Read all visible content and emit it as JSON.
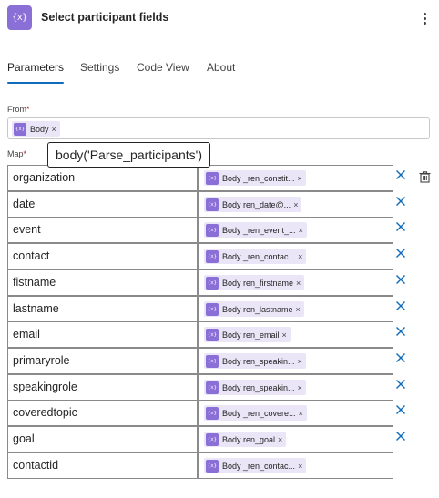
{
  "header": {
    "app_icon": "{x}",
    "title": "Select participant fields",
    "menu_icon": "more-vertical-icon"
  },
  "tabs": [
    {
      "label": "Parameters",
      "active": true
    },
    {
      "label": "Settings",
      "active": false
    },
    {
      "label": "Code View",
      "active": false
    },
    {
      "label": "About",
      "active": false
    }
  ],
  "from": {
    "label": "From",
    "required_mark": "*",
    "token": {
      "icon": "{x}",
      "label": "Body",
      "remove": "×"
    }
  },
  "map": {
    "label": "Map",
    "required_mark": "*",
    "tooltip": "body('Parse_participants')",
    "rows": [
      {
        "key": "organization",
        "value": "Body _ren_constit...",
        "remove": "×"
      },
      {
        "key": "date",
        "value": "Body ren_date@...",
        "remove": "×"
      },
      {
        "key": "event",
        "value": "Body _ren_event_...",
        "remove": "×"
      },
      {
        "key": "contact",
        "value": "Body _ren_contac...",
        "remove": "×"
      },
      {
        "key": "fistname",
        "value": "Body ren_firstname",
        "remove": "×"
      },
      {
        "key": "lastname",
        "value": "Body ren_lastname",
        "remove": "×"
      },
      {
        "key": "email",
        "value": "Body ren_email",
        "remove": "×"
      },
      {
        "key": "primaryrole",
        "value": "Body ren_speakin...",
        "remove": "×"
      },
      {
        "key": "speakingrole",
        "value": "Body ren_speakin...",
        "remove": "×"
      },
      {
        "key": "coveredtopic",
        "value": "Body _ren_covere...",
        "remove": "×"
      },
      {
        "key": "goal",
        "value": "Body ren_goal",
        "remove": "×"
      },
      {
        "key": "contactid",
        "value": "Body _ren_contac...",
        "remove": "×"
      }
    ]
  },
  "colors": {
    "accent": "#0f6cbd",
    "token_bg": "#eae6f7",
    "token_icon": "#8a6fd6",
    "required": "#c50f1f"
  }
}
